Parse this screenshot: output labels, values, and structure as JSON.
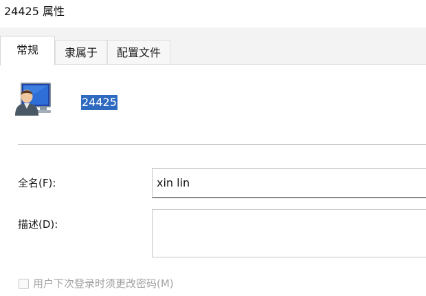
{
  "window": {
    "title": "24425 属性"
  },
  "tabs": [
    {
      "label": "常规",
      "active": true
    },
    {
      "label": "隶属于",
      "active": false
    },
    {
      "label": "配置文件",
      "active": false
    }
  ],
  "general": {
    "user_icon": "user-computer-icon",
    "user_name": "24425",
    "full_name_label": "全名(F):",
    "full_name_value": "xin lin",
    "description_label": "描述(D):",
    "description_value": "",
    "change_password_label": "用户下次登录时须更改密码(M)",
    "change_password_checked": false,
    "change_password_enabled": false
  },
  "colors": {
    "selection_highlight": "#2e6ac0",
    "tab_strip_background": "#f3f3f3",
    "disabled_text": "#a3a3a3"
  }
}
